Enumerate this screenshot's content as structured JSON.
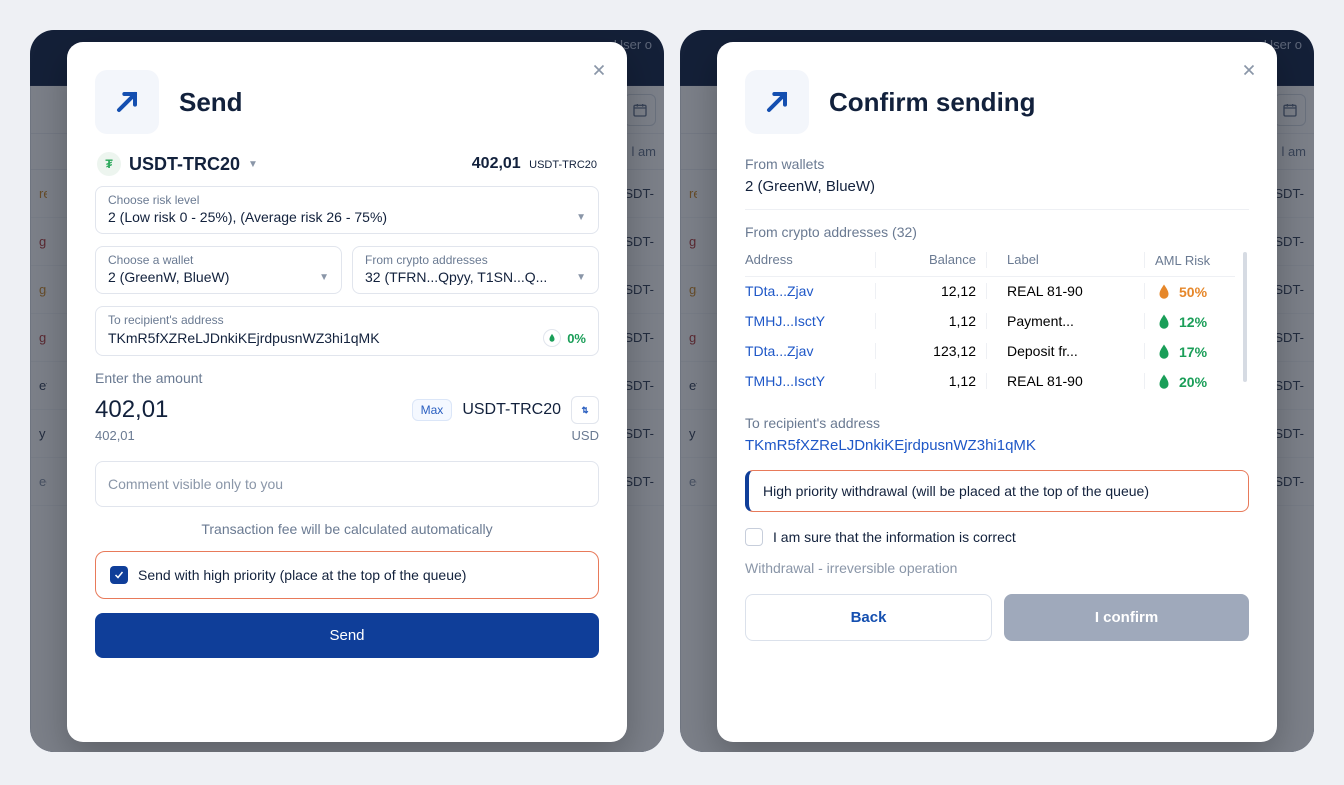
{
  "bg": {
    "user_label": "User",
    "amount_header": "l am",
    "rows": [
      {
        "class": "warn",
        "status": "requir",
        "unit": "USDT-"
      },
      {
        "class": "crit",
        "status": "g erro",
        "unit": "USDT-"
      },
      {
        "class": "warn",
        "status": "gation",
        "unit": "USDT-"
      },
      {
        "class": "crit",
        "status": "g fund",
        "unit": "USDT-"
      },
      {
        "class": "",
        "status": "eted",
        "unit": "USDT-"
      },
      {
        "class": "",
        "status": "y com",
        "unit": "USDT-"
      },
      {
        "class": "muted",
        "status": "ed",
        "unit": "USDT-"
      }
    ]
  },
  "send": {
    "title": "Send",
    "token_name": "USDT-TRC20",
    "balance": "402,01",
    "balance_unit": "USDT-TRC20",
    "risk_label": "Choose risk level",
    "risk_value": "2 (Low risk 0 - 25%), (Average risk 26 - 75%)",
    "wallet_label": "Choose a wallet",
    "wallet_value": "2 (GreenW, BlueW)",
    "from_label": "From crypto addresses",
    "from_value": "32 (TFRN...Qpyy, T1SN...Q...",
    "to_label": "To recipient's address",
    "to_value": "TKmR5fXZReLJDnkiKEjrdpusnWZ3hi1qMK",
    "to_risk": "0%",
    "enter_amount_label": "Enter the amount",
    "amount": "402,01",
    "max": "Max",
    "amount_unit": "USDT-TRC20",
    "sub_amount": "402,01",
    "sub_unit": "USD",
    "comment_placeholder": "Comment visible only to you",
    "fee_note": "Transaction fee will be calculated automatically",
    "priority_label": "Send with high priority (place at the top of the queue)",
    "send_btn": "Send"
  },
  "confirm": {
    "title": "Confirm sending",
    "from_wallets_label": "From wallets",
    "from_wallets_value": "2 (GreenW, BlueW)",
    "from_addresses_label": "From crypto addresses (32)",
    "cols": {
      "addr": "Address",
      "bal": "Balance",
      "label": "Label",
      "aml": "AML Risk"
    },
    "rows": [
      {
        "addr": "TDta...Zjav",
        "bal": "12,12",
        "label": "REAL 81-90",
        "pct": "50%",
        "color": "orange"
      },
      {
        "addr": "TMHJ...IsctY",
        "bal": "1,12",
        "label": "Payment...",
        "pct": "12%",
        "color": "green"
      },
      {
        "addr": "TDta...Zjav",
        "bal": "123,12",
        "label": "Deposit fr...",
        "pct": "17%",
        "color": "green"
      },
      {
        "addr": "TMHJ...IsctY",
        "bal": "1,12",
        "label": "REAL 81-90",
        "pct": "20%",
        "color": "green"
      }
    ],
    "to_label": "To recipient's address",
    "to_value": "TKmR5fXZReLJDnkiKEjrdpusnWZ3hi1qMK",
    "callout": "High priority withdrawal (will be placed at the top of the queue)",
    "confirm_chk": "I am sure that the information is correct",
    "irrev": "Withdrawal - irreversible operation",
    "back": "Back",
    "confirm_btn": "I confirm"
  }
}
